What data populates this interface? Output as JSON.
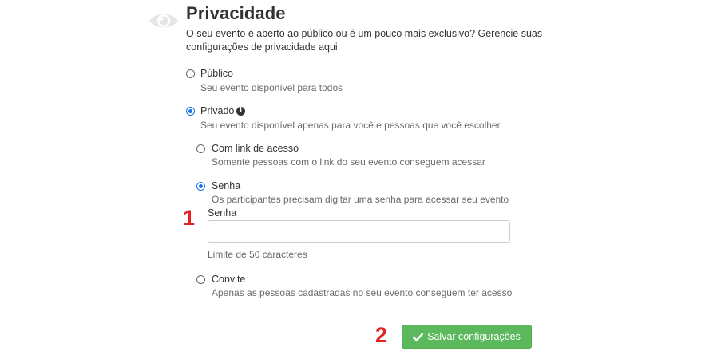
{
  "section": {
    "title": "Privacidade",
    "description": "O seu evento é aberto ao público ou é um pouco mais exclusivo? Gerencie suas configurações de privacidade aqui"
  },
  "options": {
    "public": {
      "label": "Público",
      "help": "Seu evento disponível para todos",
      "checked": false
    },
    "private": {
      "label": "Privado",
      "help": "Seu evento disponível apenas para você e pessoas que você escolher",
      "checked": true
    }
  },
  "private_options": {
    "link": {
      "label": "Com link de acesso",
      "help": "Somente pessoas com o link do seu evento conseguem acessar",
      "checked": false
    },
    "password": {
      "label": "Senha",
      "help": "Os participantes precisam digitar uma senha para acessar seu evento",
      "checked": true
    },
    "invite": {
      "label": "Convite",
      "help": "Apenas as pessoas cadastradas no seu evento conseguem ter acesso",
      "checked": false
    }
  },
  "password_field": {
    "label": "Senha",
    "value": "",
    "hint": "Limite de 50 caracteres"
  },
  "annotations": {
    "step1": "1",
    "step2": "2"
  },
  "actions": {
    "save_label": "Salvar configurações"
  },
  "colors": {
    "accent": "#1a73e8",
    "save_button": "#5cb85c",
    "annotation": "#e02424"
  },
  "icons": {
    "section": "eye-icon",
    "private_info": "info-icon",
    "save": "check-icon"
  }
}
